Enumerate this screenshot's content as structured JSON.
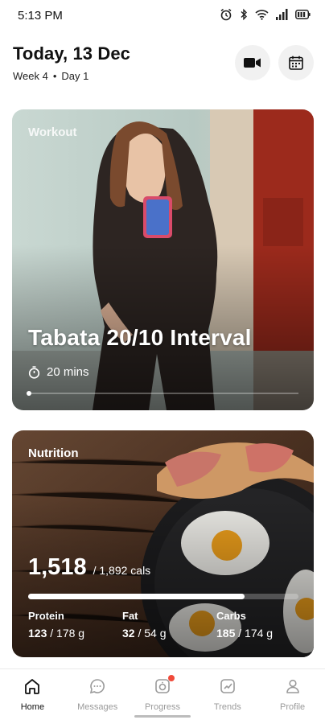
{
  "status_bar": {
    "time": "5:13 PM",
    "icons": [
      "alarm-icon",
      "bluetooth-icon",
      "wifi-icon",
      "signal-icon",
      "battery-icon"
    ]
  },
  "header": {
    "date": "Today, 13 Dec",
    "week": "Week 4",
    "separator": "•",
    "day": "Day 1",
    "video_icon": "video-camera-icon",
    "calendar_icon": "calendar-icon"
  },
  "workout": {
    "label": "Workout",
    "title": "Tabata 20/10 Interval",
    "duration": "20 mins",
    "duration_icon": "stopwatch-icon",
    "progress": 0.0
  },
  "nutrition": {
    "label": "Nutrition",
    "calories": "1,518",
    "calorie_goal": "/ 1,892 cals",
    "progress": 0.8,
    "macros": [
      {
        "name": "Protein",
        "value": "123",
        "goal": "/ 178 g"
      },
      {
        "name": "Fat",
        "value": "32",
        "goal": "/ 54 g"
      },
      {
        "name": "Carbs",
        "value": "185",
        "goal": "/ 174 g"
      }
    ]
  },
  "nav": {
    "items": [
      {
        "label": "Home",
        "icon": "home-icon",
        "active": true
      },
      {
        "label": "Messages",
        "icon": "chat-bubble-icon",
        "active": false
      },
      {
        "label": "Progress",
        "icon": "progress-camera-icon",
        "active": false,
        "badge": true
      },
      {
        "label": "Trends",
        "icon": "trends-chart-icon",
        "active": false
      },
      {
        "label": "Profile",
        "icon": "person-icon",
        "active": false
      }
    ]
  },
  "colors": {
    "accent": "#111111",
    "inactive": "#9a9a9a",
    "badge": "#f04a3a"
  }
}
